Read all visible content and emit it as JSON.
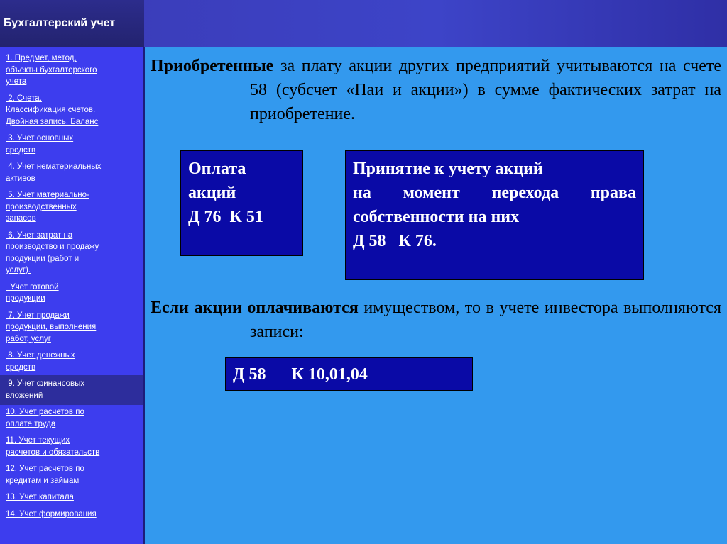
{
  "header": {
    "title": "Бухгалтерский учет"
  },
  "sidebar": {
    "items": [
      [
        "1. Предмет, метод,",
        "объекты бухгалтерского",
        "учета"
      ],
      [
        " 2. Счета.",
        "Классификация счетов.",
        "Двойная запись. Баланс"
      ],
      [
        " 3. Учет основных",
        "средств"
      ],
      [
        " 4. Учет нематериальных",
        "активов"
      ],
      [
        " 5. Учет материально-",
        "производственных",
        "запасов"
      ],
      [
        " 6. Учет затрат на",
        "производство и продажу",
        "продукции (работ и",
        "услуг)."
      ],
      [
        "  Учет готовой",
        "продукции"
      ],
      [
        " 7. Учет продажи",
        "продукции, выполнения",
        "работ, услуг"
      ],
      [
        " 8. Учет денежных",
        "средств"
      ],
      [
        " 9. Учет финансовых",
        "вложений"
      ],
      [
        "10. Учет расчетов по",
        "оплате труда"
      ],
      [
        "11. Учет текущих",
        "расчетов и обязательств"
      ],
      [
        "12. Учет расчетов по",
        "кредитам и займам"
      ],
      [
        "13. Учет капитала"
      ],
      [
        "14. Учет формирования"
      ]
    ]
  },
  "content": {
    "para1": {
      "bold_part": "Приобретенные",
      "rest": " за плату акции других предприятий учитываются на счете 58 (субсчет «Паи и акции») в сумме фактических затрат на приобретение."
    },
    "box_payment": {
      "line1": "Оплата",
      "line2": "акций",
      "line3": "Д 76  К 51"
    },
    "box_acceptance": {
      "line1": "Принятие к учету акций",
      "line2": " на момент перехода права собственности на них",
      "line3": "Д 58   К 76."
    },
    "para2": {
      "bold_part": "Если акции оплачиваются",
      "rest": " имуществом, то в учете инвестора выполняются записи:"
    },
    "box_entry": {
      "text": "Д 58      К 10,01,04"
    }
  }
}
